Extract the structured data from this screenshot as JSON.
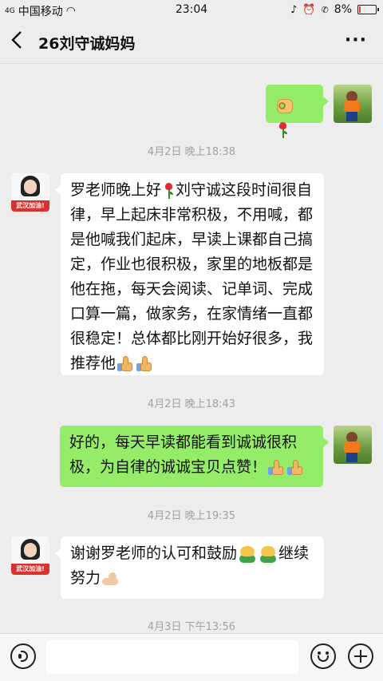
{
  "status_bar": {
    "signal": "4G",
    "carrier": "中国移动",
    "time": "23:04",
    "battery_percent": "8%",
    "battery_color": "#e53935"
  },
  "header": {
    "back_icon": "chevron-left-icon",
    "title": "26刘守诚妈妈",
    "more_icon": "more-dots-icon",
    "more_label": "···"
  },
  "messages": [
    {
      "sender": "self",
      "type": "emoji",
      "emojis": [
        "ok-hand-icon",
        "rose-icon"
      ]
    },
    {
      "type": "timestamp",
      "text": "4月2日 晚上18:38"
    },
    {
      "sender": "teacher",
      "text": "罗老师晚上好",
      "rest": "刘守诚这段时间很自律，早上起床非常积极，不用喊，都是他喊我们起床，早读上课都自己搞定，作业也很积极，家里的地板都是他在拖，每天会阅读、记单词、完成口算一篇，做家务，在家情绪一直都很稳定！总体都比刚开始好很多，我推荐他",
      "avatar_banner": "武汉加油!"
    },
    {
      "type": "timestamp",
      "text": "4月2日 晚上18:43"
    },
    {
      "sender": "self",
      "text": "好的，每天早读都能看到诚诚很积极，为自律的诚诚宝贝点赞！"
    },
    {
      "type": "timestamp",
      "text": "4月2日 晚上19:35"
    },
    {
      "sender": "teacher",
      "text": "谢谢罗老师的认可和鼓励",
      "rest": "继续努力",
      "avatar_banner": "武汉加油!"
    },
    {
      "type": "timestamp",
      "text": "4月3日 下午13:56"
    }
  ],
  "input_bar": {
    "voice_icon": "voice-icon",
    "emoji_icon": "emoji-smile-icon",
    "plus_icon": "plus-icon",
    "value": ""
  },
  "colors": {
    "background": "#ededed",
    "outgoing_bubble": "#95ec69",
    "incoming_bubble": "#ffffff",
    "timestamp_text": "#a3a3a3"
  }
}
